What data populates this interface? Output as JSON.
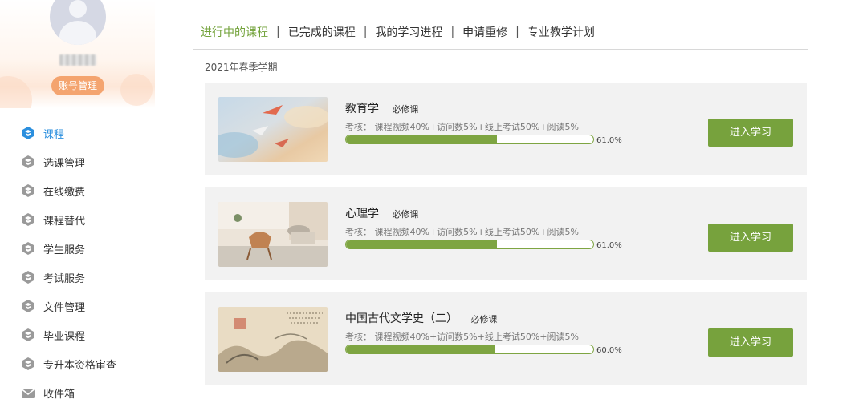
{
  "sidebar": {
    "account_button": "账号管理",
    "items": [
      {
        "label": "课程",
        "icon": "course-icon",
        "active": true
      },
      {
        "label": "选课管理",
        "icon": "gear-hex-icon"
      },
      {
        "label": "在线缴费",
        "icon": "gear-hex-icon"
      },
      {
        "label": "课程替代",
        "icon": "gear-hex-icon"
      },
      {
        "label": "学生服务",
        "icon": "gear-hex-icon"
      },
      {
        "label": "考试服务",
        "icon": "gear-hex-icon"
      },
      {
        "label": "文件管理",
        "icon": "gear-hex-icon"
      },
      {
        "label": "毕业课程",
        "icon": "gear-hex-icon"
      },
      {
        "label": "专升本资格审查",
        "icon": "gear-hex-icon"
      },
      {
        "label": "收件箱",
        "icon": "mail-icon"
      }
    ]
  },
  "tabs": [
    {
      "label": "进行中的课程",
      "active": true
    },
    {
      "label": "已完成的课程"
    },
    {
      "label": "我的学习进程"
    },
    {
      "label": "申请重修"
    },
    {
      "label": "专业教学计划"
    }
  ],
  "term": "2021年春季学期",
  "courses": [
    {
      "title": "教育学",
      "tag": "必修课",
      "assessment": "考核： 课程视频40%+访问数5%+线上考试50%+阅读5%",
      "progress": 61.0,
      "progress_text": "61.0%",
      "button": "进入学习"
    },
    {
      "title": "心理学",
      "tag": "必修课",
      "assessment": "考核： 课程视频40%+访问数5%+线上考试50%+阅读5%",
      "progress": 61.0,
      "progress_text": "61.0%",
      "button": "进入学习"
    },
    {
      "title": "中国古代文学史（二）",
      "tag": "必修课",
      "assessment": "考核： 课程视频40%+访问数5%+线上考试50%+阅读5%",
      "progress": 60.0,
      "progress_text": "60.0%",
      "button": "进入学习"
    }
  ],
  "colors": {
    "accent_green": "#77a23d",
    "active_blue": "#2b8fde",
    "account_orange": "#f4a46f"
  }
}
